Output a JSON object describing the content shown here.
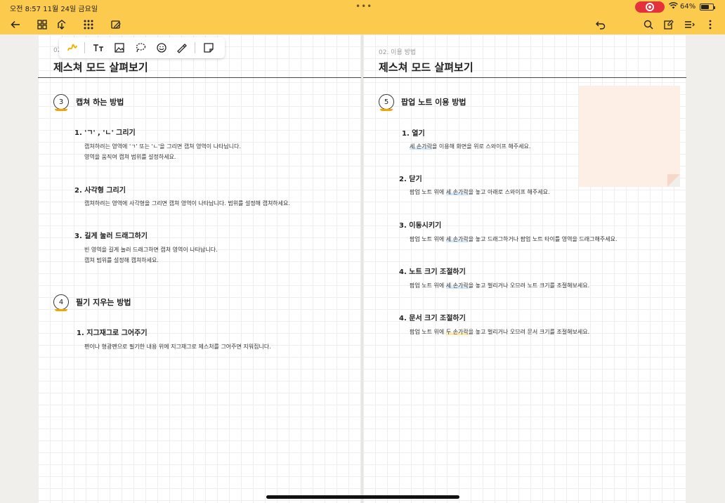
{
  "status_bar": {
    "time_date": "오전 8:57   11월 24일 금요일",
    "battery": "64%",
    "dots": "•••"
  },
  "toolbar_icons": [
    "back-icon",
    "thumbnails-icon",
    "export-icon",
    "grid-icon",
    "pen-edit-icon",
    "undo-icon",
    "search-icon",
    "page-icon",
    "outline-icon",
    "more-icon"
  ],
  "tools": [
    "highlighter-icon",
    "text-icon",
    "image-icon",
    "lasso-icon",
    "sticker-icon",
    "eraser-pen-icon",
    "sticky-note-icon"
  ],
  "left_page": {
    "chapter": "02",
    "title": "제스쳐 모드 살펴보기",
    "sections": [
      {
        "num": "3",
        "title": "캡쳐 하는 방법"
      },
      {
        "num": "4",
        "title": "필기 지우는 방법"
      }
    ],
    "subs": [
      {
        "title": "1. 'ㄱ' , 'ㄴ' 그리기",
        "lines": [
          "캡쳐하려는 영역에 'ㄱ' 또는 'ㄴ'을 그리면 캡쳐 영역이 나타납니다.",
          "영역을 움직여 캡쳐 범위를 설정하세요."
        ]
      },
      {
        "title": "2. 사각형 그리기",
        "lines": [
          "캡쳐하려는 영역에 사각형을 그리면 캡쳐 영역이 나타납니다. 범위를 설정해 캡쳐하세요."
        ]
      },
      {
        "title": "3. 길게 눌러 드래그하기",
        "lines": [
          "빈 영역을 길게 눌러 드래그하면 캡쳐 영역이 나타납니다.",
          "캡쳐 범위를 설정해 캡쳐하세요."
        ]
      },
      {
        "title": "1. 지그재그로 그어주기",
        "lines": [
          "펜이나 형광펜으로 필기한 내용 위에 지그재그로 제스처를 그어주면 지워집니다."
        ]
      }
    ]
  },
  "right_page": {
    "chapter": "02. 이용 방법",
    "title": "제스쳐 모드 살펴보기",
    "section": {
      "num": "5",
      "title": "팝업 노트 이용 방법"
    },
    "subs": [
      {
        "title": "1. 열기",
        "pre": "",
        "hl": "세 손가락",
        "post": "을 이용해 화면을 위로 스와이프 해주세요."
      },
      {
        "title": "2. 닫기",
        "pre": "팝업 노트 위에 ",
        "hl": "세 손가락",
        "post": "을 놓고 아래로 스와이프 해주세요."
      },
      {
        "title": "3. 이동시키기",
        "pre": "팝업 노트 위에 ",
        "hl": "세 손가락",
        "post": "을 놓고 드래그하거나 팝업 노트 타이틀 영역을 드래그해주세요."
      },
      {
        "title": "4. 노트 크기 조절하기",
        "pre": "팝업 노트 위에 ",
        "hl": "세 손가락",
        "post": "을 놓고 벌리거나 오므려 노트 크기를 조절해보세요."
      },
      {
        "title": "4. 문서 크기 조절하기",
        "pre": "팝업 노트 위에 ",
        "hl": "두 손가락",
        "post": "을 놓고 벌리거나 오므려 문서 크기를 조절해보세요."
      }
    ]
  },
  "colors": {
    "accent": "#fcca4d",
    "record": "#e5313a",
    "underline": "#f0a500",
    "sticky": "#fdeee6"
  }
}
